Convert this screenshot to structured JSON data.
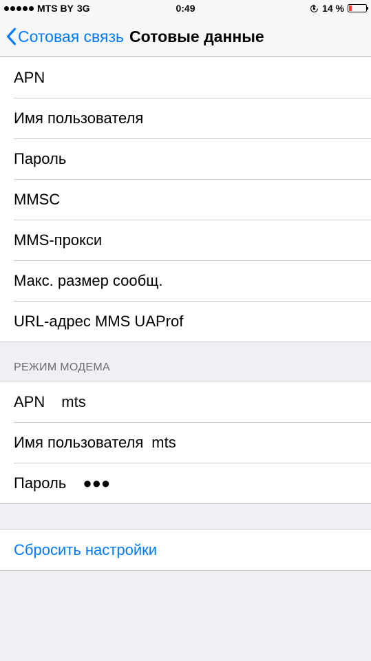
{
  "status": {
    "carrier": "MTS BY",
    "network": "3G",
    "time": "0:49",
    "battery_pct": "14 %"
  },
  "nav": {
    "back_label": "Сотовая связь",
    "title": "Сотовые данные"
  },
  "group1": {
    "apn_label": "APN",
    "username_label": "Имя пользователя",
    "password_label": "Пароль",
    "mmsc_label": "MMSC",
    "mms_proxy_label": "MMS-прокси",
    "max_msg_label": "Макс. размер сообщ.",
    "uaprof_label": "URL-адрес MMS UAProf"
  },
  "section2_header": "РЕЖИМ МОДЕМА",
  "group2": {
    "apn_label": "APN",
    "apn_value": "mts",
    "username_label": "Имя пользователя",
    "username_value": "mts",
    "password_label": "Пароль",
    "password_value": "●●●"
  },
  "reset_label": "Сбросить настройки"
}
